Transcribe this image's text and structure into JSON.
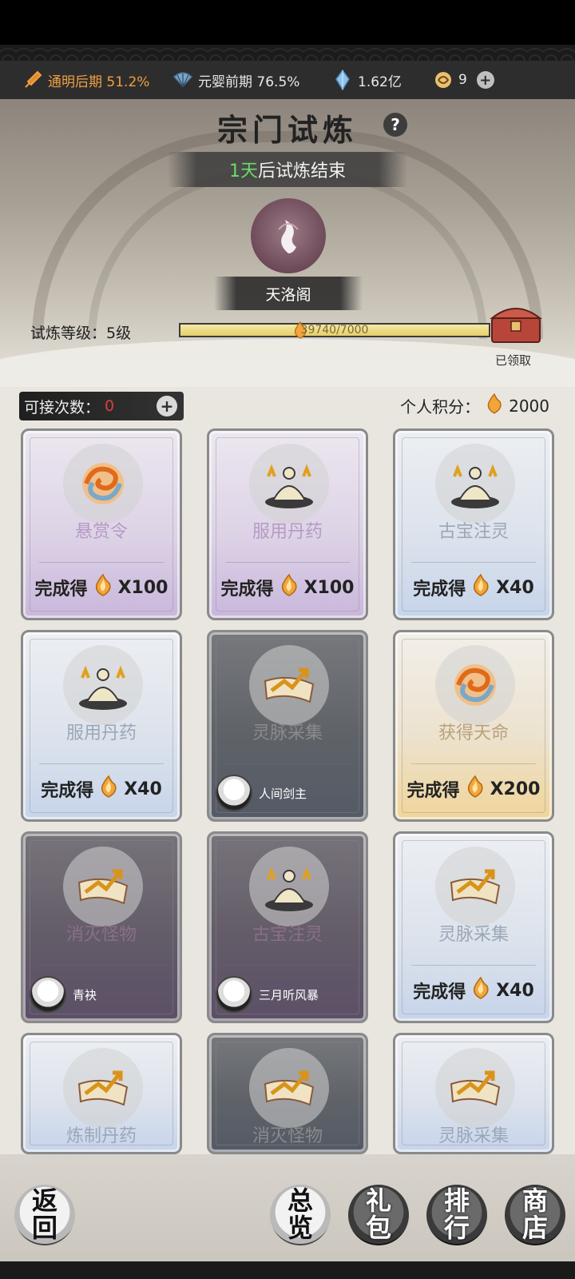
{
  "resources": [
    {
      "icon": "sword-icon",
      "text": "通明后期 51.2%"
    },
    {
      "icon": "fan-icon",
      "text": "元婴前期 76.5%"
    },
    {
      "icon": "crystal-icon",
      "text": "1.62亿"
    },
    {
      "icon": "swirl-icon",
      "text": "9"
    }
  ],
  "header": {
    "title": "宗门试炼",
    "countdown_days": "1天",
    "countdown_suffix": "后试炼结束",
    "sect_name": "天洛阁"
  },
  "trial": {
    "level_label": "试炼等级：5级",
    "progress_text": "39740/7000",
    "progress_fraction": 1.0,
    "chest_status": "已领取"
  },
  "accept": {
    "label": "可接次数：",
    "value": "0"
  },
  "score": {
    "label": "个人积分：",
    "value": "2000"
  },
  "cards": [
    {
      "name": "悬赏令",
      "style": "purple",
      "icon": "swirl-orb-icon",
      "reward_label": "完成得",
      "reward": "X100"
    },
    {
      "name": "服用丹药",
      "style": "purple",
      "icon": "meditating-sage-icon",
      "reward_label": "完成得",
      "reward": "X100"
    },
    {
      "name": "古宝注灵",
      "style": "blue",
      "icon": "meditating-sage-icon",
      "reward_label": "完成得",
      "reward": "X40"
    },
    {
      "name": "服用丹药",
      "style": "blue",
      "icon": "meditating-sage-icon",
      "reward_label": "完成得",
      "reward": "X40"
    },
    {
      "name": "灵脉采集",
      "style": "dark",
      "icon": "scroll-arrow-icon",
      "player": "人间剑主"
    },
    {
      "name": "获得天命",
      "style": "gold",
      "icon": "swirl-orb-icon",
      "reward_label": "完成得",
      "reward": "X200"
    },
    {
      "name": "消灭怪物",
      "style": "dark-purple",
      "icon": "scroll-arrow-icon",
      "player": "青袂"
    },
    {
      "name": "古宝注灵",
      "style": "dark-purple",
      "icon": "meditating-sage-icon",
      "player": "三月听风暴"
    },
    {
      "name": "灵脉采集",
      "style": "blue",
      "icon": "scroll-arrow-icon",
      "reward_label": "完成得",
      "reward": "X40"
    },
    {
      "name": "炼制丹药",
      "style": "blue",
      "icon": "scroll-arrow-icon"
    },
    {
      "name": "消灭怪物",
      "style": "dark",
      "icon": "scroll-arrow-icon"
    },
    {
      "name": "灵脉采集",
      "style": "blue",
      "icon": "scroll-arrow-icon"
    }
  ],
  "nav": {
    "back": "返回",
    "overview": "总览",
    "gift": "礼包",
    "rank": "排行",
    "shop": "商店"
  },
  "colors": {
    "accent_orange": "#f0a040",
    "countdown_green": "#6bdc6b",
    "zero_red": "#e23b3b"
  }
}
